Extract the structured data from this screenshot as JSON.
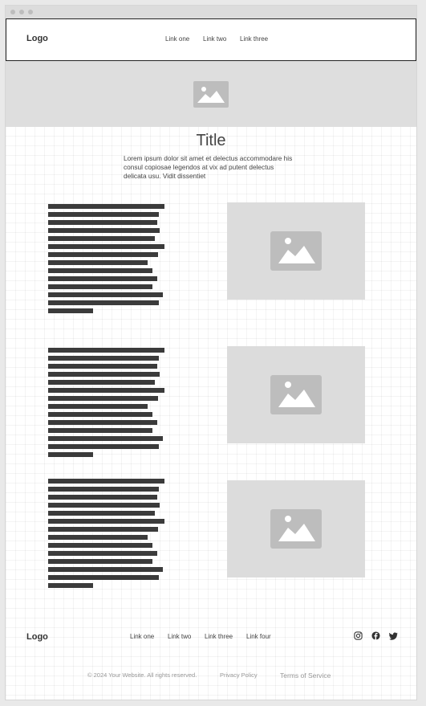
{
  "header": {
    "logo": "Logo",
    "links": [
      "Link one",
      "Link two",
      "Link three"
    ]
  },
  "main": {
    "title": "Title",
    "lead_text": "Lorem ipsum dolor sit amet et delectus accommodare his consul copiosae legendos at vix ad putent delectus delicata usu. Vidit dissentiet"
  },
  "footer": {
    "logo": "Logo",
    "links": [
      "Link one",
      "Link two",
      "Link three",
      "Link four"
    ],
    "social_icons": [
      "instagram-icon",
      "facebook-icon",
      "twitter-icon"
    ],
    "copyright": "© 2024 Your Website. All rights reserved.",
    "privacy": "Privacy Policy",
    "terms": "Terms of Service"
  },
  "colors": {
    "placeholder_bg": "#dcdcdc",
    "placeholder_icon": "#bdbdbd",
    "text_bar": "#3b3b3b"
  }
}
